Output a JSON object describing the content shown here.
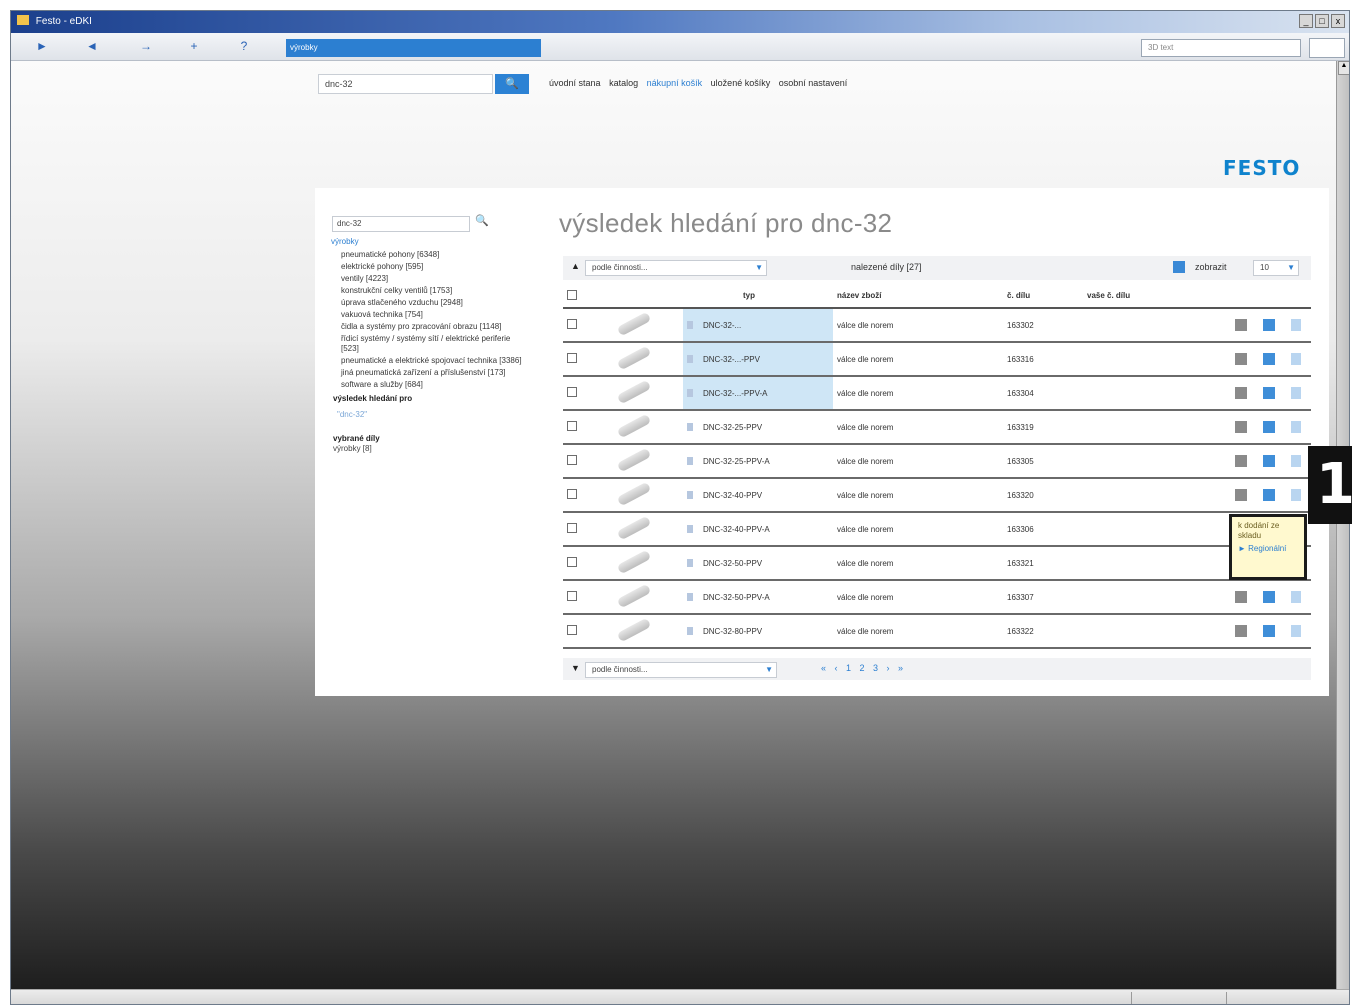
{
  "window": {
    "title": "Festo - eDKI",
    "controls": [
      "_",
      "□",
      "x"
    ]
  },
  "browser": {
    "nav_buttons": [
      "►",
      "◄",
      "→",
      "+",
      "?"
    ],
    "tab_label": "výrobky",
    "addr_right": "3D text"
  },
  "header": {
    "search_value": "dnc-32",
    "search_button": "🔍",
    "links": [
      "úvodní stana",
      "katalog",
      "nákupní košík",
      "uložené košíky",
      "osobní nastavení"
    ],
    "logo": "FESTO"
  },
  "sidebar": {
    "search_value": "dnc-32",
    "heading": "výrobky",
    "categories": [
      "pneumatické pohony [6348]",
      "elektrické pohony [595]",
      "ventily [4223]",
      "konstrukční celky ventilů [1753]",
      "úprava stlačeného vzduchu [2948]",
      "vakuová technika [754]",
      "čidla a systémy pro zpracování obrazu [1148]",
      "řídicí systémy / systémy sítí / elektrické periferie [523]",
      "pneumatické a elektrické spojovací technika [3386]",
      "jiná pneumatická zařízení a příslušenství [173]",
      "software a služby [684]"
    ],
    "result_heading": "výsledek hledání pro",
    "result_term": "\"dnc-32\"",
    "selected_heading": "vybrané díly",
    "selected_item": "výrobky [8]"
  },
  "main": {
    "title": "výsledek hledání pro dnc-32",
    "sort_select": "podle činnosti...",
    "found_label": "nalezené díly [27]",
    "per_page_label": "zobrazit",
    "per_page_value": "10",
    "columns": [
      "",
      "",
      "typ",
      "název zboží",
      "č. dílu",
      "vaše č. dílu",
      ""
    ],
    "rows": [
      {
        "type": "DNC-32-...",
        "name": "válce dle norem",
        "part": "163302",
        "hl": true
      },
      {
        "type": "DNC-32-...-PPV",
        "name": "válce dle norem",
        "part": "163316",
        "hl": true
      },
      {
        "type": "DNC-32-...-PPV-A",
        "name": "válce dle norem",
        "part": "163304",
        "hl": true
      },
      {
        "type": "DNC-32-25-PPV",
        "name": "válce dle norem",
        "part": "163319",
        "hl": false
      },
      {
        "type": "DNC-32-25-PPV-A",
        "name": "válce dle norem",
        "part": "163305",
        "hl": false
      },
      {
        "type": "DNC-32-40-PPV",
        "name": "válce dle norem",
        "part": "163320",
        "hl": false
      },
      {
        "type": "DNC-32-40-PPV-A",
        "name": "válce dle norem",
        "part": "163306",
        "hl": false
      },
      {
        "type": "DNC-32-50-PPV",
        "name": "válce dle norem",
        "part": "163321",
        "hl": false
      },
      {
        "type": "DNC-32-50-PPV-A",
        "name": "válce dle norem",
        "part": "163307",
        "hl": false
      },
      {
        "type": "DNC-32-80-PPV",
        "name": "válce dle norem",
        "part": "163322",
        "hl": false
      }
    ],
    "bottom_select": "podle činnosti...",
    "pager": "« ‹ 1 2 3 › »"
  },
  "tooltip": {
    "text": "k dodání ze skladu",
    "link": "► Regionální"
  },
  "callout": "1"
}
